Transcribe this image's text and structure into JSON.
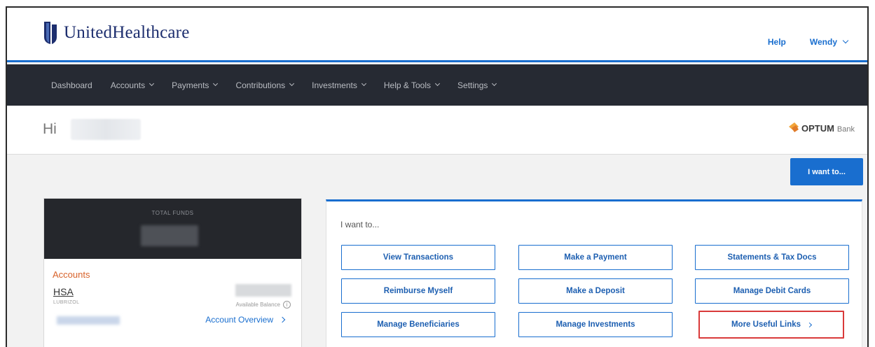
{
  "header": {
    "logo_text": "UnitedHealthcare",
    "help_label": "Help",
    "user_label": "Wendy"
  },
  "nav": {
    "items": [
      {
        "label": "Dashboard"
      },
      {
        "label": "Accounts"
      },
      {
        "label": "Payments"
      },
      {
        "label": "Contributions"
      },
      {
        "label": "Investments"
      },
      {
        "label": "Help & Tools"
      },
      {
        "label": "Settings"
      }
    ]
  },
  "greeting": {
    "hi": "Hi",
    "optum_text": "OPTUM",
    "optum_bank": "Bank"
  },
  "iwant_button": "I want to...",
  "funds": {
    "total_label": "TOTAL FUNDS",
    "accounts_title": "Accounts",
    "account_name": "HSA",
    "employer": "LUBRIZOL",
    "available_label": "Available Balance",
    "overview_link": "Account Overview"
  },
  "actions": {
    "title": "I want to...",
    "buttons": [
      {
        "label": "View Transactions"
      },
      {
        "label": "Make a Payment"
      },
      {
        "label": "Statements & Tax Docs"
      },
      {
        "label": "Reimburse Myself"
      },
      {
        "label": "Make a Deposit"
      },
      {
        "label": "Manage Debit Cards"
      },
      {
        "label": "Manage Beneficiaries"
      },
      {
        "label": "Manage Investments"
      },
      {
        "label": "More Useful Links"
      }
    ]
  },
  "colors": {
    "accent": "#196ecf",
    "nav_bg": "#262a33",
    "accounts_orange": "#d7622a",
    "highlight_red": "#d93a3a"
  }
}
